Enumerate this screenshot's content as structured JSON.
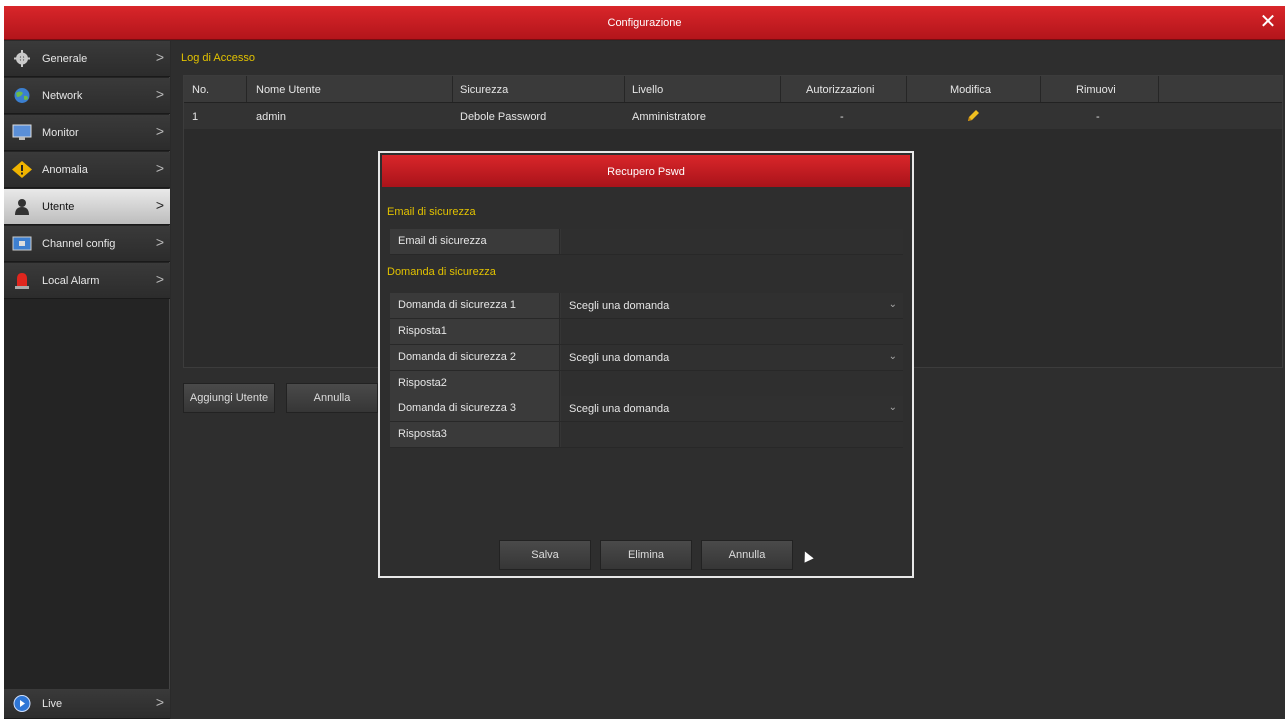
{
  "window": {
    "title": "Configurazione",
    "close_icon": "close-icon"
  },
  "sidebar": {
    "items": [
      {
        "label": "Generale",
        "icon": "gear-icon"
      },
      {
        "label": "Network",
        "icon": "globe-icon"
      },
      {
        "label": "Monitor",
        "icon": "monitor-icon"
      },
      {
        "label": "Anomalia",
        "icon": "warning-icon"
      },
      {
        "label": "Utente",
        "icon": "user-icon",
        "active": true
      },
      {
        "label": "Channel config",
        "icon": "camera-icon"
      },
      {
        "label": "Local Alarm",
        "icon": "alarm-icon"
      }
    ],
    "bottom": {
      "label": "Live",
      "icon": "live-icon"
    }
  },
  "main": {
    "section_title": "Log di Accesso",
    "table": {
      "headers": [
        "No.",
        "Nome Utente",
        "Sicurezza",
        "Livello",
        "Autorizzazioni",
        "Modifica",
        "Rimuovi"
      ],
      "rows": [
        {
          "no": "1",
          "user": "admin",
          "security": "Debole Password",
          "level": "Amministratore",
          "auth": "-",
          "edit_icon": "pencil-icon",
          "remove": "-"
        }
      ]
    },
    "buttons": {
      "add_user": "Aggiungi Utente",
      "cancel": "Annulla"
    }
  },
  "modal": {
    "title": "Recupero Pswd",
    "email_section": "Email di sicurezza",
    "email_label": "Email di sicurezza",
    "email_value": "",
    "question_section": "Domanda di sicurezza",
    "questions": [
      {
        "label": "Domanda di sicurezza 1",
        "selected": "Scegli una domanda",
        "answer_label": "Risposta1",
        "answer": ""
      },
      {
        "label": "Domanda di sicurezza 2",
        "selected": "Scegli una domanda",
        "answer_label": "Risposta2",
        "answer": ""
      },
      {
        "label": "Domanda di sicurezza 3",
        "selected": "Scegli una domanda",
        "answer_label": "Risposta3",
        "answer": ""
      }
    ],
    "buttons": {
      "save": "Salva",
      "delete": "Elimina",
      "cancel": "Annulla"
    }
  },
  "colors": {
    "accent_red": "#c81e23",
    "section_yellow": "#e2c200"
  }
}
